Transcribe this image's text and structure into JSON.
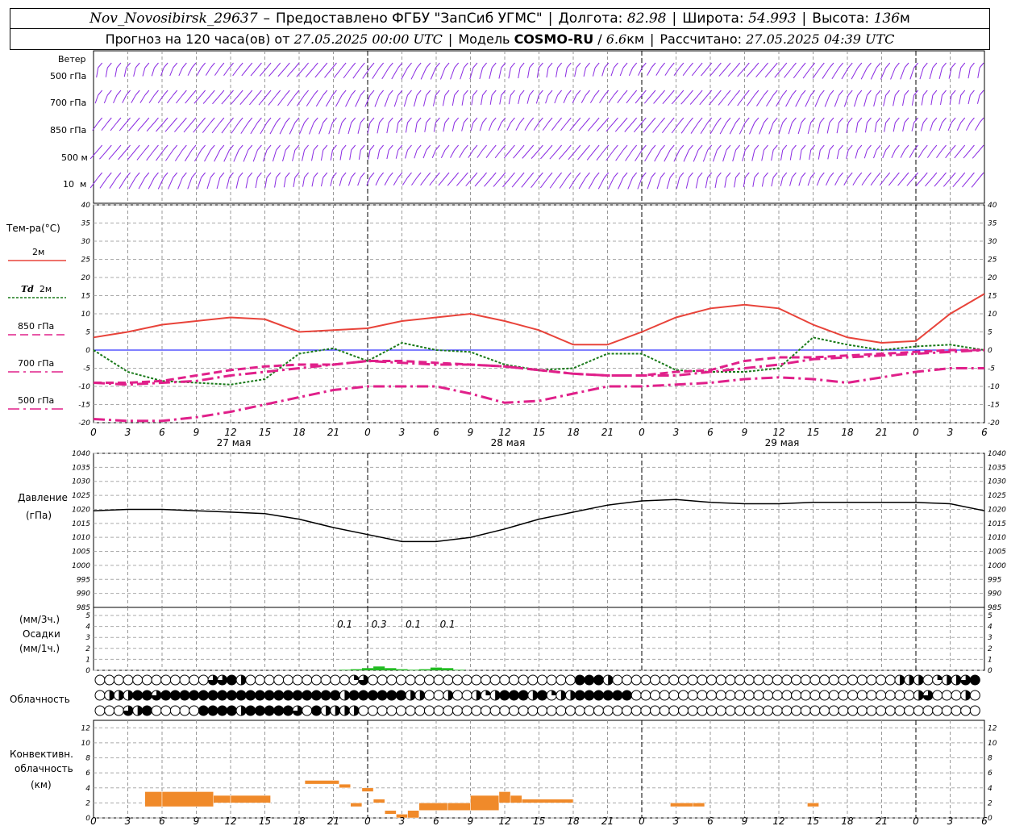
{
  "header": {
    "station": "Nov_Novosibirsk_29637",
    "dash": "–",
    "provider": "Предоставлено ФГБУ \"ЗапСиб УГМС\"",
    "lon_label": "Долгота:",
    "lon": "82.98",
    "lat_label": "Широта:",
    "lat": "54.993",
    "alt_label": "Высота:",
    "alt": "136",
    "alt_unit": "м",
    "forecast_label": "Прогноз на 120 часа(ов) от",
    "forecast_start": "27.05.2025 00:00 UTC",
    "model_label": "Модель",
    "model": "COSMO-RU",
    "slash": "/",
    "resolution": "6.6",
    "res_unit": "км",
    "computed_label": "Рассчитано:",
    "computed": "27.05.2025 04:39 UTC"
  },
  "labels": {
    "wind": "Ветер",
    "wind_levels": [
      "500 гПа",
      "700 гПа",
      "850 гПа",
      "500 м",
      "10  м"
    ],
    "temperature": "Тем-ра(°C)",
    "t2m": "2м",
    "td_sym": "Td",
    "td2m": "2м",
    "t850": "850 гПа",
    "t700": "700 гПа",
    "t500": "500 гПа",
    "pressure": "Давление",
    "pressure_unit": "(гПа)",
    "precip_3h": "(мм/3ч.)",
    "precip": "Осадки",
    "precip_1h": "(мм/1ч.)",
    "cloudiness": "Облачность",
    "conv1": "Конвективн.",
    "conv2": "облачность",
    "conv3": "(км)"
  },
  "colors": {
    "t2m": "#e8433a",
    "td": "#1a7a1a",
    "t850": "#e0208a",
    "t700": "#e0208a",
    "t500": "#e0208a",
    "wind": "#8a2be2",
    "pressure": "#000000",
    "precip": "#22bb22",
    "convective": "#f08a2a",
    "zero_line": "#0000ff"
  },
  "chart_data": [
    {
      "type": "line",
      "name": "temperature",
      "x_hours": [
        0,
        3,
        6,
        9,
        12,
        15,
        18,
        21,
        24,
        27,
        30,
        33,
        36,
        39,
        42,
        45,
        48,
        51,
        54,
        57,
        60,
        63,
        66,
        69,
        72,
        75,
        78
      ],
      "x_tick_labels": [
        "0",
        "3",
        "6",
        "9",
        "12",
        "15",
        "18",
        "21",
        "0",
        "3",
        "6",
        "9",
        "12",
        "15",
        "18",
        "21",
        "0",
        "3",
        "6",
        "9",
        "12",
        "15",
        "18",
        "21",
        "0",
        "3",
        "6"
      ],
      "day_labels": [
        "27 мая",
        "28 мая",
        "29 мая"
      ],
      "ylim": [
        -20,
        40
      ],
      "yticks": [
        -20,
        -15,
        -10,
        -5,
        0,
        5,
        10,
        15,
        20,
        25,
        30,
        35,
        40
      ],
      "series": [
        {
          "key": "t2m",
          "values": [
            3.5,
            5,
            7,
            8,
            9,
            8.5,
            5,
            5.5,
            6,
            8,
            9,
            10,
            8,
            5.5,
            1.5,
            1.5,
            5,
            9,
            11.5,
            12.5,
            11.5,
            7,
            3.5,
            2,
            2.5,
            10,
            15.5
          ]
        },
        {
          "key": "td",
          "values": [
            0,
            -6,
            -8.5,
            -9,
            -9.5,
            -8,
            -1,
            0.5,
            -3,
            2,
            0,
            -0.5,
            -4,
            -5.5,
            -5,
            -1,
            -1,
            -5.5,
            -6,
            -6,
            -5,
            3.5,
            1.5,
            0,
            1,
            1.5,
            0
          ]
        },
        {
          "key": "t850",
          "values": [
            -9,
            -9,
            -8.5,
            -7,
            -5.5,
            -4.5,
            -4,
            -4,
            -3,
            -3,
            -3.5,
            -4,
            -4.5,
            -5.5,
            -6.5,
            -7,
            -7,
            -6,
            -5.5,
            -3,
            -2,
            -2,
            -1.5,
            -1,
            -0.5,
            0,
            0
          ]
        },
        {
          "key": "t700",
          "values": [
            -9,
            -9.5,
            -9,
            -8.5,
            -7,
            -6,
            -5,
            -4,
            -3,
            -3.5,
            -4,
            -4,
            -4.5,
            -5.5,
            -6.5,
            -7,
            -7,
            -7,
            -6,
            -5,
            -4,
            -2.5,
            -2,
            -1.5,
            -1,
            -0.5,
            0
          ]
        },
        {
          "key": "t500",
          "values": [
            -19,
            -19.5,
            -19.5,
            -18.5,
            -17,
            -15,
            -13,
            -11,
            -10,
            -10,
            -10,
            -12,
            -14.5,
            -14,
            -12,
            -10,
            -10,
            -9.5,
            -9,
            -8,
            -7.5,
            -8,
            -9,
            -7.5,
            -6,
            -5,
            -5
          ]
        }
      ]
    },
    {
      "type": "line",
      "name": "pressure",
      "ylim": [
        985,
        1040
      ],
      "yticks": [
        985,
        990,
        995,
        1000,
        1005,
        1010,
        1015,
        1020,
        1025,
        1030,
        1035,
        1040
      ],
      "x_hours": [
        0,
        3,
        6,
        9,
        12,
        15,
        18,
        21,
        24,
        27,
        30,
        33,
        36,
        39,
        42,
        45,
        48,
        51,
        54,
        57,
        60,
        63,
        66,
        69,
        72,
        75,
        78
      ],
      "values": [
        1019.5,
        1020,
        1020,
        1019.5,
        1019,
        1018.5,
        1016.5,
        1013.5,
        1011,
        1008.5,
        1008.5,
        1010,
        1013,
        1016.5,
        1019,
        1021.5,
        1023,
        1023.5,
        1022.5,
        1022,
        1022,
        1022.5,
        1022.5,
        1022.5,
        1022.5,
        1022,
        1019.5
      ]
    },
    {
      "type": "bar",
      "name": "precipitation",
      "ylim": [
        0,
        5
      ],
      "yticks": [
        0,
        1,
        2,
        3,
        4,
        5
      ],
      "annotations": [
        {
          "x_hour": 22,
          "text": "0.1"
        },
        {
          "x_hour": 25,
          "text": "0.3"
        },
        {
          "x_hour": 28,
          "text": "0.1"
        },
        {
          "x_hour": 31,
          "text": "0.1"
        }
      ],
      "x_hours": [
        22,
        23,
        24,
        25,
        26,
        27,
        28,
        29,
        30,
        31,
        32
      ],
      "values": [
        0.05,
        0.1,
        0.2,
        0.35,
        0.2,
        0.1,
        0.05,
        0.1,
        0.25,
        0.2,
        0.05
      ]
    },
    {
      "type": "table",
      "name": "cloudiness",
      "rows": [
        "0000000000003342000000000001300000000000000000000004442000000000000000000000000000000222012234",
        "0222443444444444444444444424444442200200212444241224444440000000000000000000000000000002300020",
        "0003240000044442444443042222000000000000000000000000000000000000000000000000000000000000000000"
      ]
    },
    {
      "type": "bar",
      "name": "convective_cloud",
      "ylim": [
        0,
        13
      ],
      "yticks": [
        0,
        2,
        4,
        6,
        8,
        10,
        12
      ],
      "segments": [
        {
          "x0": 4.5,
          "x1": 6,
          "top": 3.5,
          "bottom": 1.5
        },
        {
          "x0": 6,
          "x1": 10.5,
          "top": 3.5,
          "bottom": 1.5
        },
        {
          "x0": 10.5,
          "x1": 12,
          "top": 3,
          "bottom": 2
        },
        {
          "x0": 12,
          "x1": 15.5,
          "top": 3,
          "bottom": 2
        },
        {
          "x0": 18.5,
          "x1": 21.5,
          "top": 5,
          "bottom": 4.5
        },
        {
          "x0": 21.5,
          "x1": 22.5,
          "top": 4.5,
          "bottom": 4
        },
        {
          "x0": 22.5,
          "x1": 23.5,
          "top": 2,
          "bottom": 1.5
        },
        {
          "x0": 23.5,
          "x1": 24.5,
          "top": 4,
          "bottom": 3.5
        },
        {
          "x0": 24.5,
          "x1": 25.5,
          "top": 2.5,
          "bottom": 2
        },
        {
          "x0": 25.5,
          "x1": 26.5,
          "top": 1,
          "bottom": 0.5
        },
        {
          "x0": 26.5,
          "x1": 27.5,
          "top": 0.5,
          "bottom": 0
        },
        {
          "x0": 27.5,
          "x1": 28.5,
          "top": 1,
          "bottom": 0
        },
        {
          "x0": 28.5,
          "x1": 31,
          "top": 2,
          "bottom": 1
        },
        {
          "x0": 31,
          "x1": 33,
          "top": 2,
          "bottom": 1
        },
        {
          "x0": 33,
          "x1": 35.5,
          "top": 3,
          "bottom": 1
        },
        {
          "x0": 35.5,
          "x1": 36.5,
          "top": 3.5,
          "bottom": 2
        },
        {
          "x0": 36.5,
          "x1": 37.5,
          "top": 3,
          "bottom": 2
        },
        {
          "x0": 37.5,
          "x1": 42,
          "top": 2.5,
          "bottom": 2
        },
        {
          "x0": 50.5,
          "x1": 52.5,
          "top": 2,
          "bottom": 1.5
        },
        {
          "x0": 52.5,
          "x1": 53.5,
          "top": 2,
          "bottom": 1.5
        },
        {
          "x0": 62.5,
          "x1": 63.5,
          "top": 2,
          "bottom": 1.5
        }
      ]
    }
  ]
}
